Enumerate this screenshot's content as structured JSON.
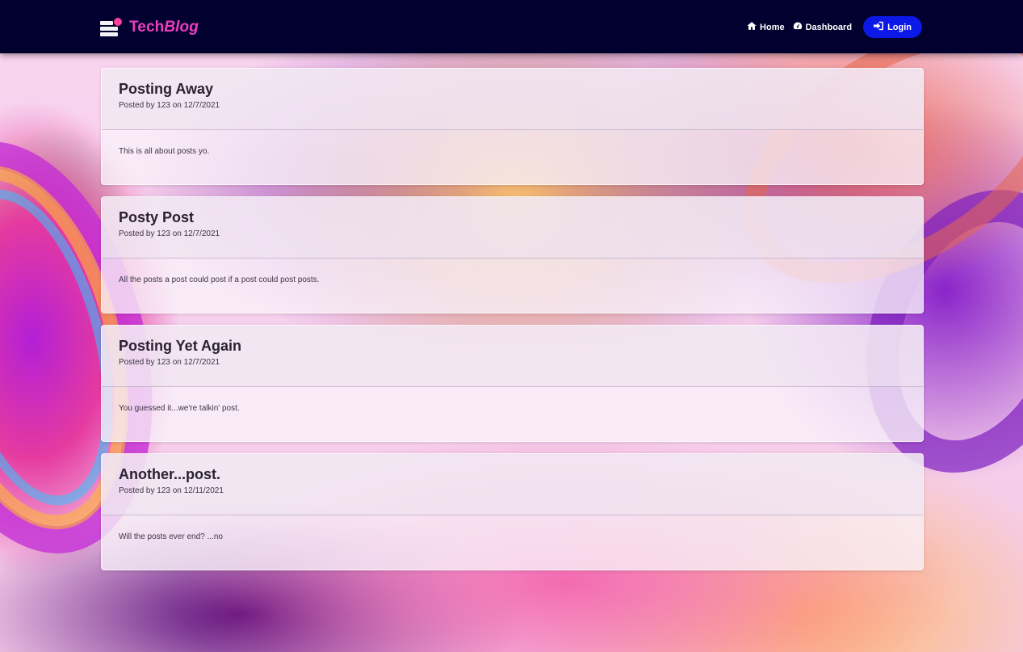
{
  "nav": {
    "brand": {
      "text_main": "Tech",
      "text_italic": "Blog"
    },
    "links": [
      {
        "label": "Home",
        "icon": "home-icon"
      },
      {
        "label": "Dashboard",
        "icon": "dashboard-gauge-icon"
      }
    ],
    "login": {
      "label": "Login",
      "icon": "sign-in-icon"
    },
    "colors": {
      "navbar": "#02002e",
      "brand": "#ec3ec0",
      "login_button": "#0c19e6"
    }
  },
  "posts": [
    {
      "title": "Posting Away",
      "meta": "Posted by 123 on 12/7/2021",
      "body": "This is all about posts yo."
    },
    {
      "title": "Posty Post",
      "meta": "Posted by 123 on 12/7/2021",
      "body": "All the posts a post could post if a post could post posts."
    },
    {
      "title": "Posting Yet Again",
      "meta": "Posted by 123 on 12/7/2021",
      "body": "You guessed it...we're talkin' post."
    },
    {
      "title": "Another...post.",
      "meta": "Posted by 123 on 12/11/2021",
      "body": "Will the posts ever end? ...no"
    }
  ]
}
